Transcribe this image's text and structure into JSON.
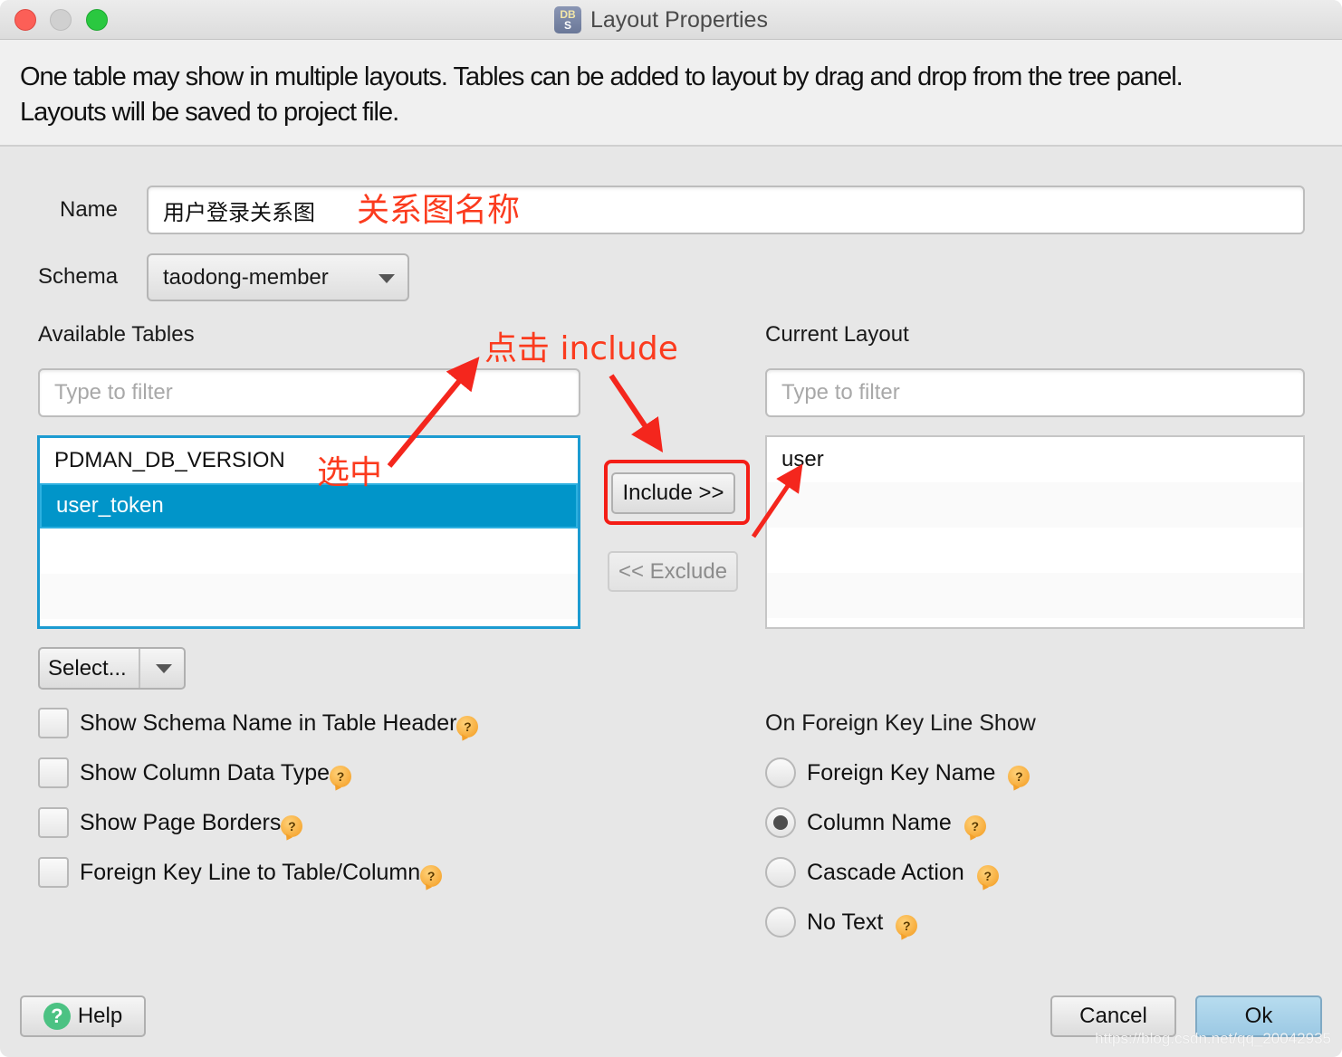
{
  "window": {
    "title": "Layout Properties",
    "app_icon": {
      "name": "dbs-app-icon",
      "top": "DB",
      "bottom": "S"
    },
    "traffic_lights": [
      "close",
      "minimize",
      "maximize"
    ]
  },
  "description": {
    "line1": "One table may show in multiple layouts. Tables can be added to layout by drag and drop from the tree panel.",
    "line2": "Layouts will be saved to project file."
  },
  "form": {
    "name_label": "Name",
    "name_value": "用户登录关系图",
    "schema_label": "Schema",
    "schema_value": "taodong-member"
  },
  "available": {
    "label": "Available Tables",
    "filter_placeholder": "Type to filter",
    "items": [
      {
        "label": "PDMAN_DB_VERSION",
        "selected": false
      },
      {
        "label": "user_token",
        "selected": true
      }
    ],
    "select_button": "Select..."
  },
  "current": {
    "label": "Current Layout",
    "filter_placeholder": "Type to filter",
    "items": [
      {
        "label": "user"
      }
    ]
  },
  "transfer": {
    "include": "Include >>",
    "exclude": "<< Exclude"
  },
  "options": {
    "checkboxes": [
      {
        "label": "Show Schema Name in Table Header",
        "checked": false
      },
      {
        "label": "Show Column Data Type",
        "checked": false
      },
      {
        "label": "Show Page Borders",
        "checked": false
      },
      {
        "label": "Foreign Key Line to Table/Column",
        "checked": false
      }
    ],
    "fk_group_label": "On Foreign Key Line Show",
    "radios": [
      {
        "label": "Foreign Key Name",
        "checked": false
      },
      {
        "label": "Column Name",
        "checked": true
      },
      {
        "label": "Cascade Action",
        "checked": false
      },
      {
        "label": "No Text",
        "checked": false
      }
    ],
    "help_glyph": "?"
  },
  "footer": {
    "help": "Help",
    "help_glyph": "?",
    "cancel": "Cancel",
    "ok": "Ok"
  },
  "annotations": {
    "name_note": "关系图名称",
    "click_include": "点击 include",
    "select_note": "选中",
    "color": "#fb3b1e"
  },
  "watermark": "https://blog.csdn.net/qq_20042935",
  "colors": {
    "selection": "#0195c9",
    "focus_border": "#1c9bd1",
    "ok_button": "#a9d3ea",
    "help_green": "#4cc283",
    "help_orange": "#f39a1e"
  }
}
